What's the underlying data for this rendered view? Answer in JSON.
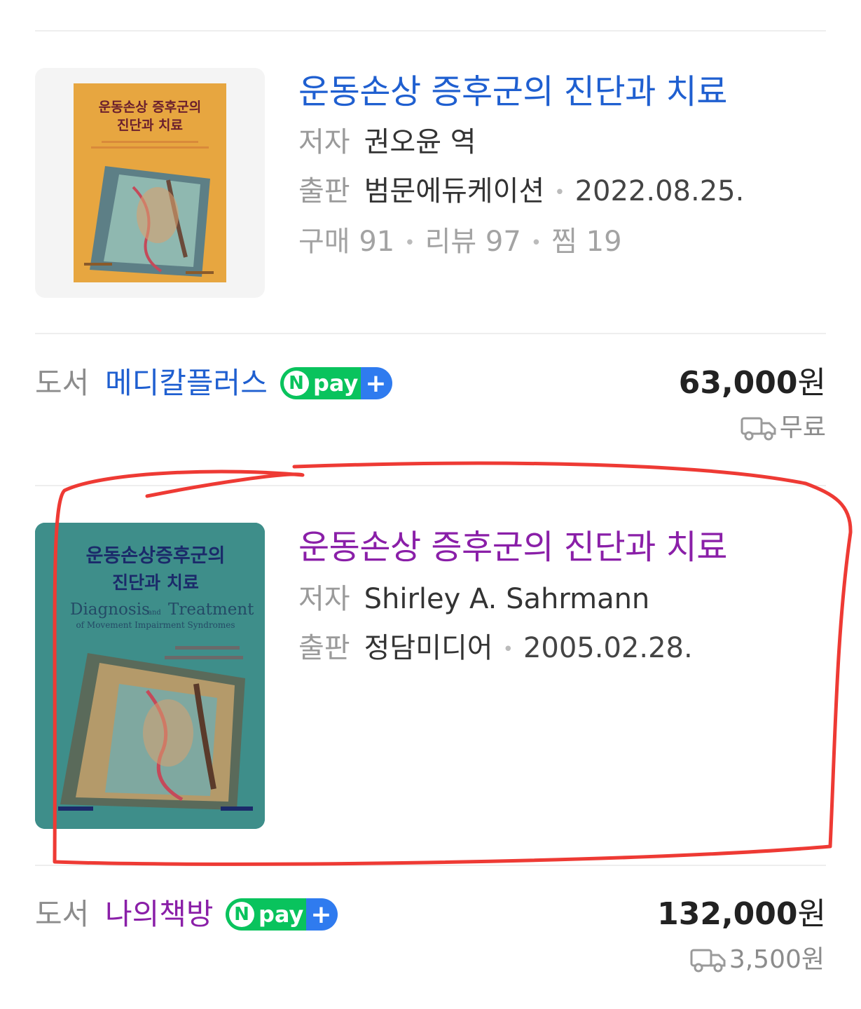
{
  "items": [
    {
      "title": "운동손상 증후군의 진단과 치료",
      "author_label": "저자",
      "author": "권오윤 역",
      "publisher_label": "출판",
      "publisher": "범문에듀케이션",
      "date": "2022.08.25.",
      "stats": {
        "purchases": "구매 91",
        "reviews": "리뷰 97",
        "wishes": "찜 19"
      },
      "cover": {
        "title_line1": "운동손상 증후군의",
        "title_line2": "진단과 치료",
        "bg": "#e7a640",
        "title_color": "#6a1f2d"
      },
      "seller": {
        "category": "도서",
        "name": "메디칼플러스",
        "npay": "pay"
      },
      "price": "63,000",
      "price_unit": "원",
      "shipping": "무료"
    },
    {
      "title": "운동손상 증후군의 진단과 치료",
      "author_label": "저자",
      "author": "Shirley A. Sahrmann",
      "publisher_label": "출판",
      "publisher": "정담미디어",
      "date": "2005.02.28.",
      "cover": {
        "title_line1": "운동손상증후군의",
        "title_line2": "진단과 치료",
        "subtitle_a": "Diagnosis",
        "subtitle_and": "and",
        "subtitle_b": "Treatment",
        "subtitle_line2": "of Movement Impairment Syndromes",
        "bg": "#3e8e8a",
        "title_color": "#1b2a6a"
      },
      "seller": {
        "category": "도서",
        "name": "나의책방",
        "npay": "pay"
      },
      "price": "132,000",
      "price_unit": "원",
      "shipping": "3,500원"
    }
  ],
  "colors": {
    "title_link": "#1f5fd0",
    "title_visited": "#8a1fa8",
    "npay_green": "#09c35d",
    "npay_blue": "#2f7bef",
    "annotation_red": "#ee3a34"
  },
  "icons": [
    "truck-icon",
    "npay-logo"
  ]
}
